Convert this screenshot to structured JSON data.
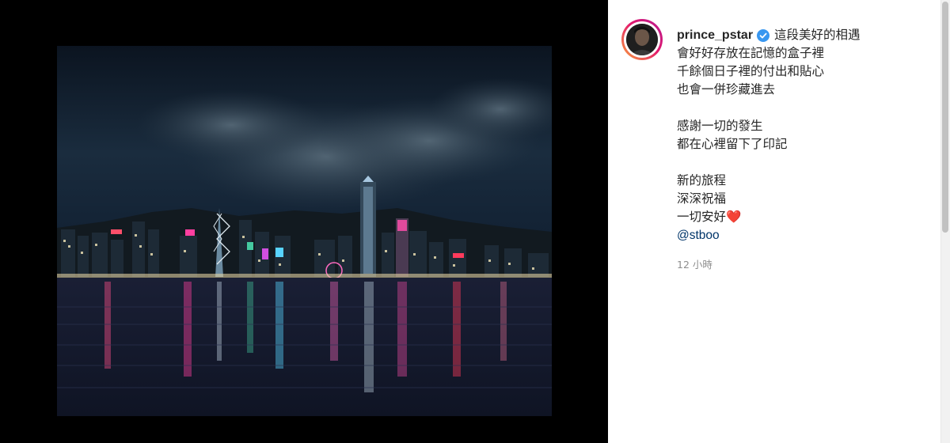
{
  "post": {
    "username": "prince_pstar",
    "caption_lines": [
      "這段美好的相遇",
      "會好好存放在記憶的盒子裡",
      "千餘個日子裡的付出和貼心",
      "也會一併珍藏進去",
      "",
      "感謝一切的發生",
      "都在心裡留下了印記",
      "",
      "新的旅程",
      "深深祝福",
      "一切安好"
    ],
    "heart_emoji": "❤️",
    "mention": "@stboo",
    "timestamp": "12 小時"
  },
  "icons": {
    "verified": "verified-badge-icon",
    "avatar": "profile-avatar"
  },
  "colors": {
    "text": "#262626",
    "mention": "#003569",
    "timestamp": "#8e8e8e",
    "verified": "#3897f0",
    "ring_start": "#f9a33b",
    "ring_end": "#b51c92"
  }
}
